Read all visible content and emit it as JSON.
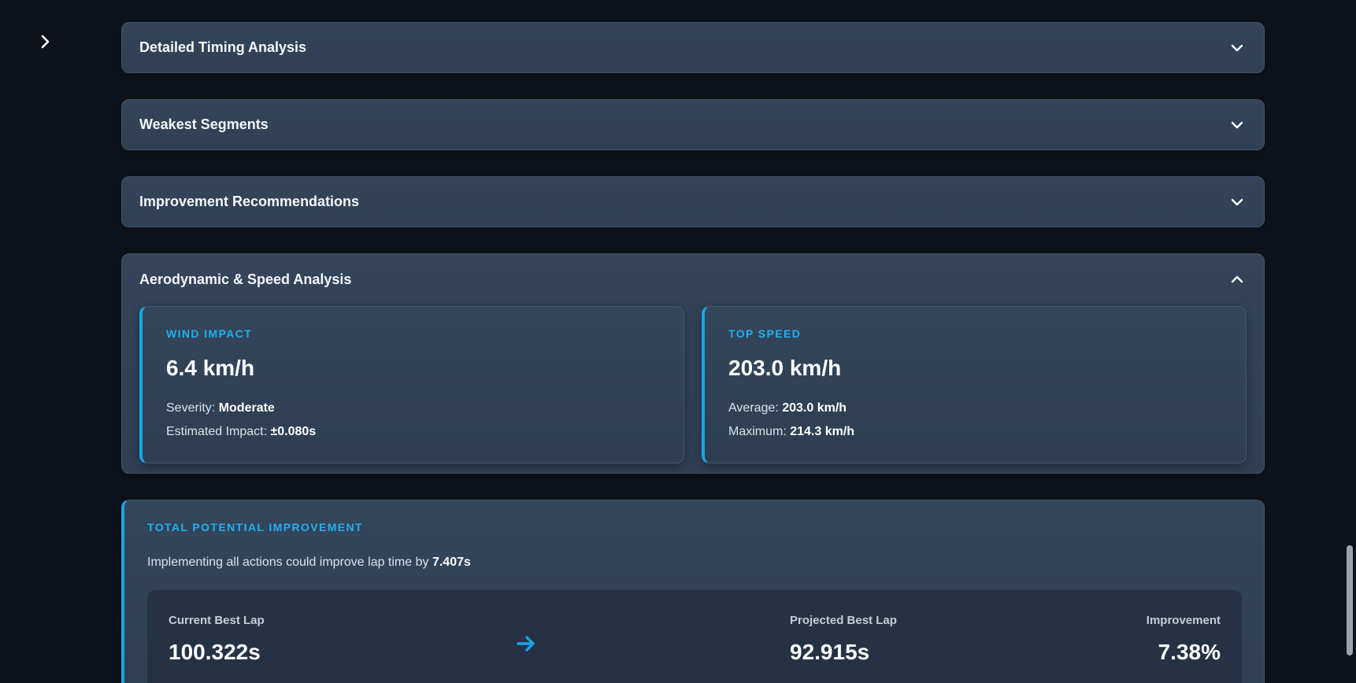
{
  "panels": [
    {
      "title": "Detailed Timing Analysis",
      "state": "collapsed"
    },
    {
      "title": "Weakest Segments",
      "state": "collapsed"
    },
    {
      "title": "Improvement Recommendations",
      "state": "collapsed"
    },
    {
      "title": "Aerodynamic & Speed Analysis",
      "state": "expanded"
    }
  ],
  "aero": {
    "wind": {
      "label": "WIND IMPACT",
      "value": "6.4 km/h",
      "severity_label": "Severity:",
      "severity_value": "Moderate",
      "impact_label": "Estimated Impact:",
      "impact_value": "±0.080s"
    },
    "speed": {
      "label": "TOP SPEED",
      "value": "203.0 km/h",
      "average_label": "Average:",
      "average_value": "203.0 km/h",
      "maximum_label": "Maximum:",
      "maximum_value": "214.3 km/h"
    }
  },
  "improvement": {
    "label": "TOTAL POTENTIAL IMPROVEMENT",
    "text_prefix": "Implementing all actions could improve lap time by",
    "text_value": "7.407s",
    "current_label": "Current Best Lap",
    "current_value": "100.322s",
    "projected_label": "Projected Best Lap",
    "projected_value": "92.915s",
    "improvement_label": "Improvement",
    "improvement_value": "7.38%"
  },
  "colors": {
    "accent": "#22b0f0",
    "panel": "#34455a",
    "background": "#0e131b"
  },
  "icons": {
    "sidebar": "chevron-right-icon",
    "collapsed": "chevron-down-icon",
    "expanded": "chevron-up-icon",
    "arrow": "arrow-right-icon"
  }
}
